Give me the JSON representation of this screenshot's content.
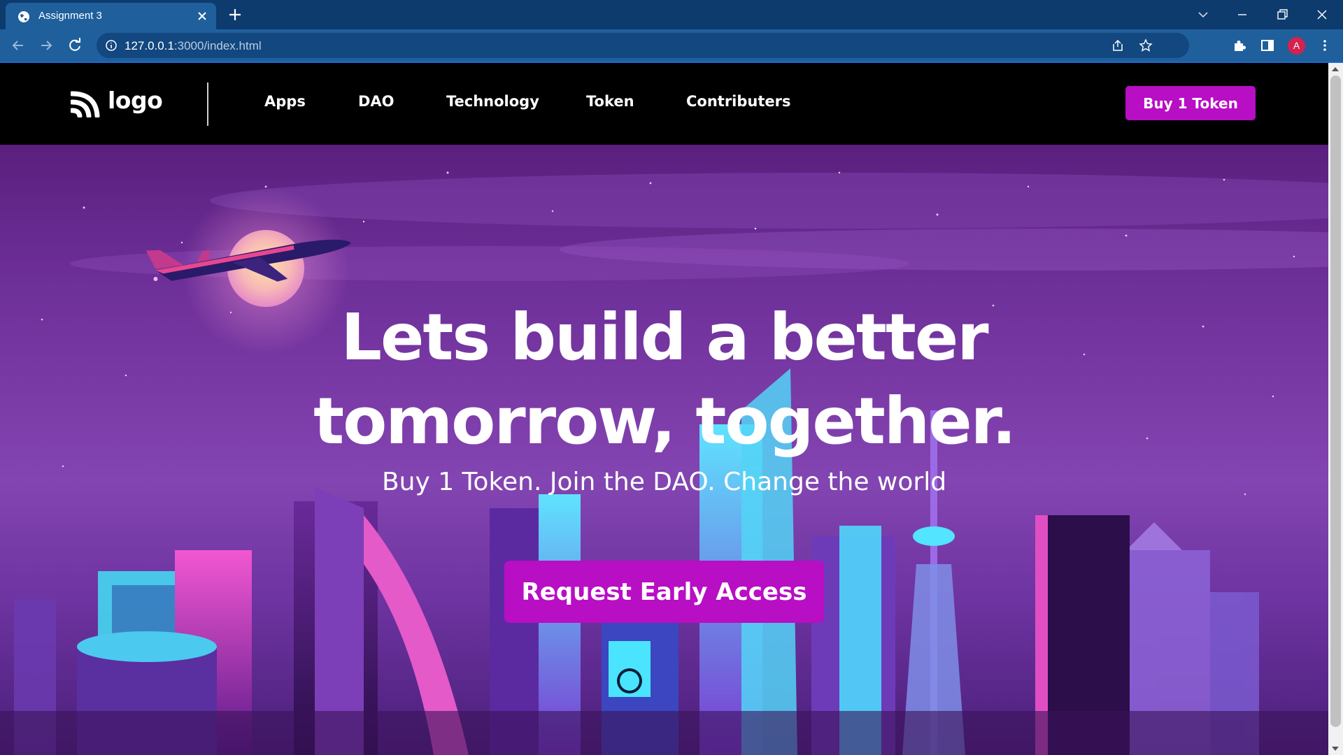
{
  "browser": {
    "tab_title": "Assignment 3",
    "url_host": "127.0.0.1",
    "url_path": ":3000/index.html",
    "profile_initial": "A",
    "colors": {
      "tabbar": "#0d3b6e",
      "toolbar": "#1f5f9c",
      "omnibox": "#12477f"
    }
  },
  "site": {
    "logo_text": "logo",
    "nav": {
      "items": [
        {
          "label": "Apps"
        },
        {
          "label": "DAO"
        },
        {
          "label": "Technology"
        },
        {
          "label": "Token"
        },
        {
          "label": "Contributers"
        }
      ],
      "cta_label": "Buy 1 Token"
    },
    "hero": {
      "headline_line1": "Lets build a better",
      "headline_line2": "tomorrow, together.",
      "subheadline": "Buy 1 Token. Join the DAO. Change the world",
      "cta_label": "Request Early Access"
    },
    "colors": {
      "accent": "#b80ec4",
      "header_bg": "#000000"
    }
  }
}
